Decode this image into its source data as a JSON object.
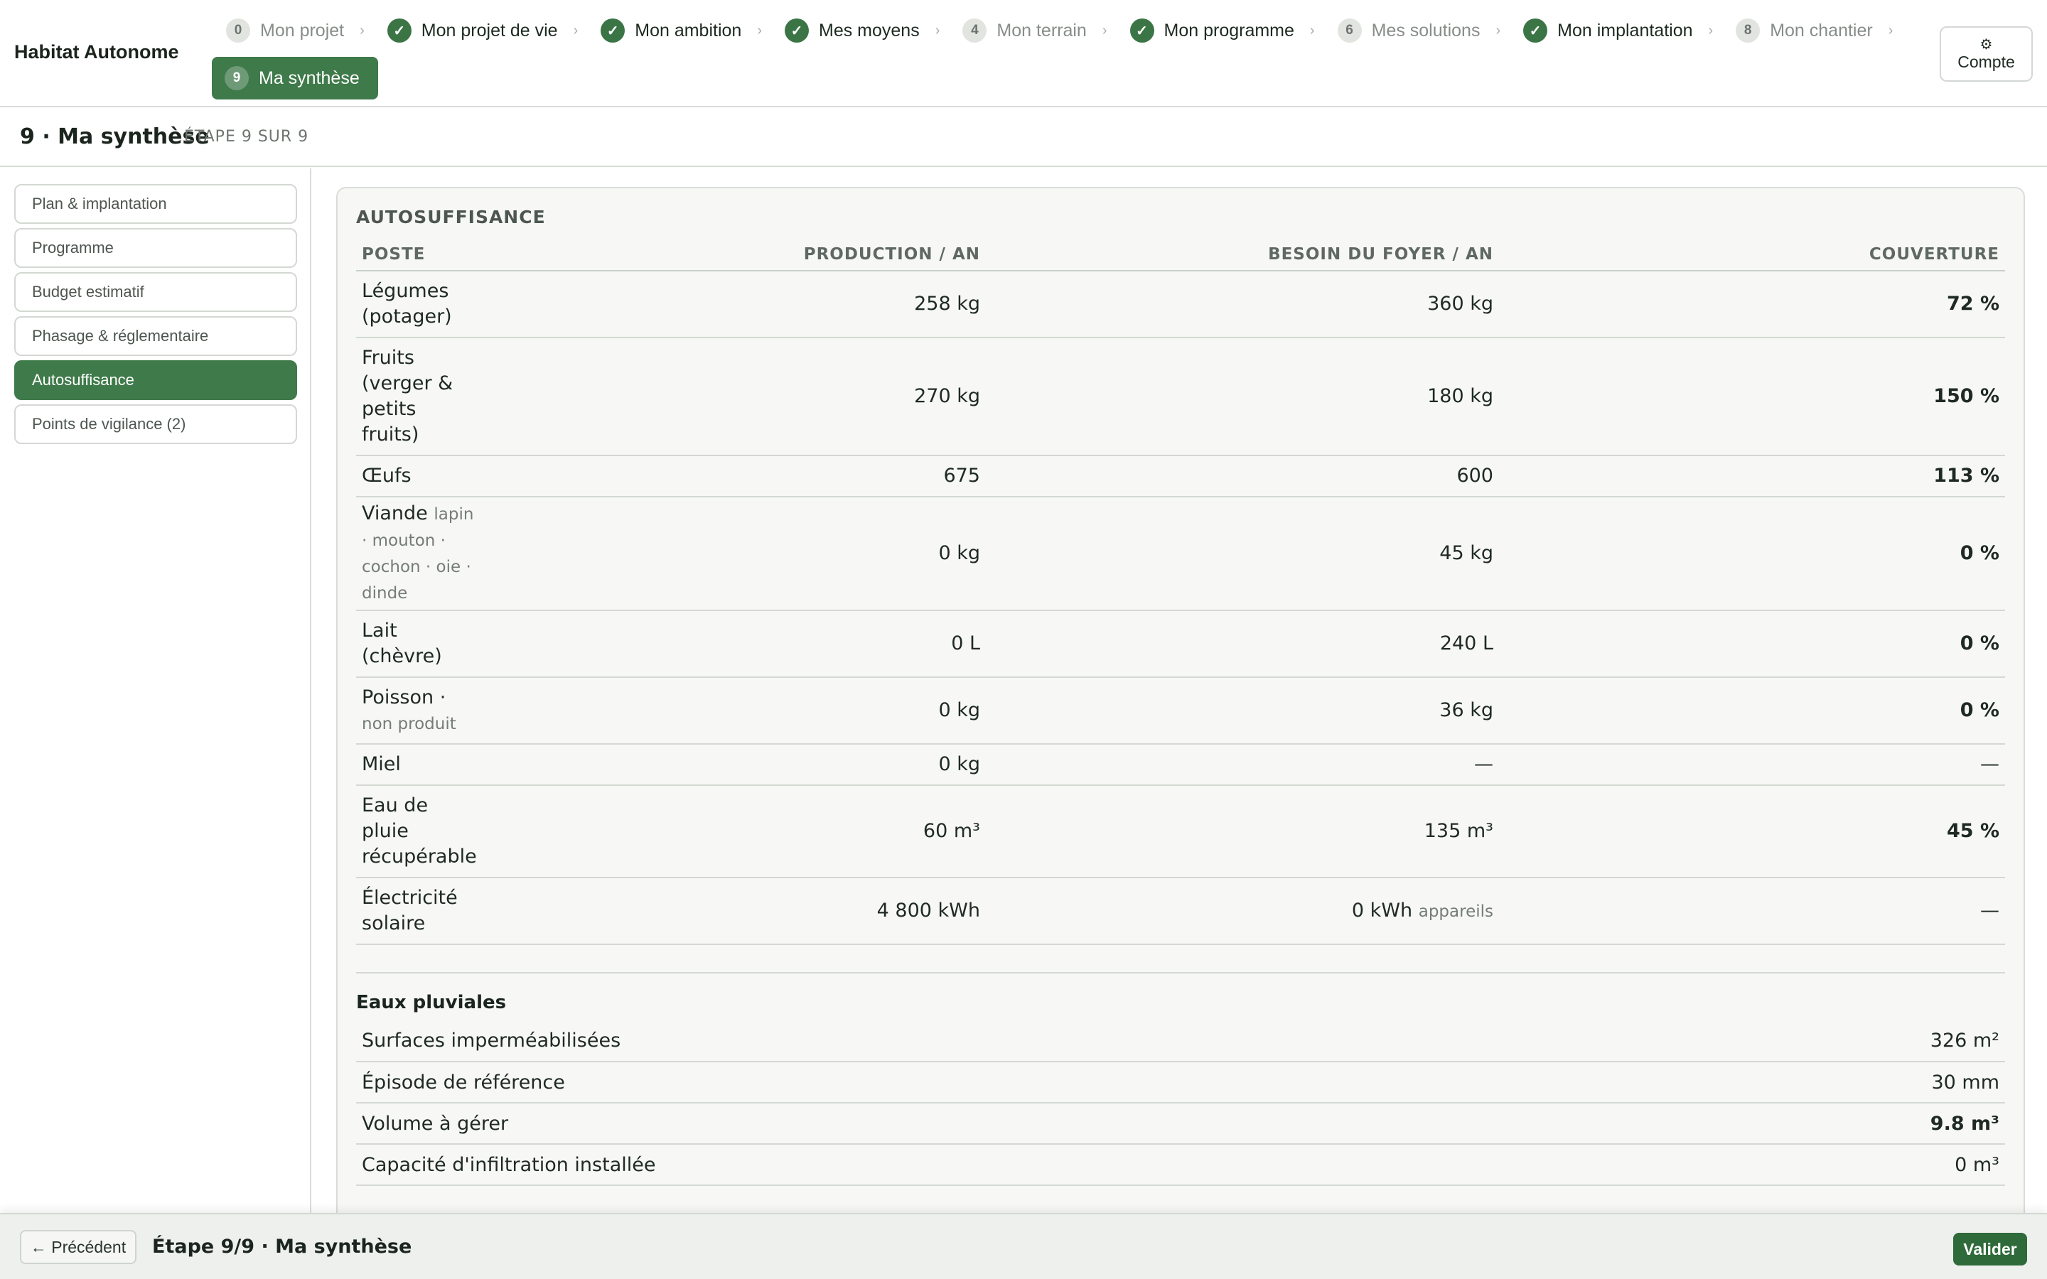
{
  "app": {
    "title": "Habitat Autonome"
  },
  "steps": [
    {
      "num": "0",
      "label": "Mon projet",
      "state": "pending"
    },
    {
      "num": "✓",
      "label": "Mon projet de vie",
      "state": "done"
    },
    {
      "num": "✓",
      "label": "Mon ambition",
      "state": "done"
    },
    {
      "num": "✓",
      "label": "Mes moyens",
      "state": "done"
    },
    {
      "num": "4",
      "label": "Mon terrain",
      "state": "pending"
    },
    {
      "num": "✓",
      "label": "Mon programme",
      "state": "done"
    },
    {
      "num": "6",
      "label": "Mes solutions",
      "state": "pending"
    },
    {
      "num": "✓",
      "label": "Mon implantation",
      "state": "done"
    },
    {
      "num": "8",
      "label": "Mon chantier",
      "state": "pending"
    },
    {
      "num": "9",
      "label": "Ma synthèse",
      "state": "active"
    }
  ],
  "step_separator": "›",
  "account": {
    "icon": "gear-icon",
    "glyph": "⚙",
    "label": "Compte"
  },
  "page": {
    "title": "9 · Ma synthèse",
    "step_indicator": "ÉTAPE 9 SUR 9"
  },
  "sidebar": {
    "items": [
      {
        "label": "Plan & implantation",
        "active": false
      },
      {
        "label": "Programme",
        "active": false
      },
      {
        "label": "Budget estimatif",
        "active": false
      },
      {
        "label": "Phasage & réglementaire",
        "active": false
      },
      {
        "label": "Autosuffisance",
        "active": true
      },
      {
        "label": "Points de vigilance (2)",
        "active": false
      }
    ]
  },
  "autosuffisance": {
    "title": "AUTOSUFFISANCE",
    "headers": {
      "poste": "POSTE",
      "production": "PRODUCTION / AN",
      "besoin": "BESOIN DU FOYER / AN",
      "couverture": "COUVERTURE"
    },
    "rows": [
      {
        "poste": "Légumes (potager)",
        "sub": "",
        "production": "258 kg",
        "besoin": "360 kg",
        "besoin_sub": "",
        "couverture": "72 %",
        "level": "yellow"
      },
      {
        "poste": "Fruits (verger & petits fruits)",
        "sub": "",
        "production": "270 kg",
        "besoin": "180 kg",
        "besoin_sub": "",
        "couverture": "150 %",
        "level": "green"
      },
      {
        "poste": "Œufs",
        "sub": "",
        "production": "675",
        "besoin": "600",
        "besoin_sub": "",
        "couverture": "113 %",
        "level": "green"
      },
      {
        "poste": "Viande",
        "sub": "lapin · mouton · cochon · oie · dinde",
        "production": "0 kg",
        "besoin": "45 kg",
        "besoin_sub": "",
        "couverture": "0 %",
        "level": "red"
      },
      {
        "poste": "Lait (chèvre)",
        "sub": "",
        "production": "0 L",
        "besoin": "240 L",
        "besoin_sub": "",
        "couverture": "0 %",
        "level": "red"
      },
      {
        "poste": "Poisson ·",
        "sub": "non produit",
        "production": "0 kg",
        "besoin": "36 kg",
        "besoin_sub": "",
        "couverture": "0 %",
        "level": "red"
      },
      {
        "poste": "Miel",
        "sub": "",
        "production": "0 kg",
        "besoin": "—",
        "besoin_sub": "",
        "couverture": "—",
        "level": "none"
      },
      {
        "poste": "Eau de pluie récupérable",
        "sub": "",
        "production": "60 m³",
        "besoin": "135 m³",
        "besoin_sub": "",
        "couverture": "45 %",
        "level": "red"
      },
      {
        "poste": "Électricité solaire",
        "sub": "",
        "production": "4 800 kWh",
        "besoin": "0 kWh",
        "besoin_sub": "appareils",
        "couverture": "—",
        "level": "none"
      }
    ]
  },
  "eaux_pluviales": {
    "title": "Eaux pluviales",
    "rows": [
      {
        "label": "Surfaces imperméabilisées",
        "value": "326 m²",
        "bold": false
      },
      {
        "label": "Épisode de référence",
        "value": "30 mm",
        "bold": false
      },
      {
        "label": "Volume à gérer",
        "value": "9.8 m³",
        "bold": true
      },
      {
        "label": "Capacité d'infiltration installée",
        "value": "0 m³",
        "bold": false
      }
    ]
  },
  "footer": {
    "prev_label": "← Précédent",
    "label": "Étape 9/9 · Ma synthèse",
    "validate_label": "Valider"
  },
  "colors": {
    "accent": "#3f7a4a",
    "coverage_yellow": "#c9932a",
    "coverage_green": "#3b9a4f",
    "coverage_red": "#cc5a2e"
  }
}
